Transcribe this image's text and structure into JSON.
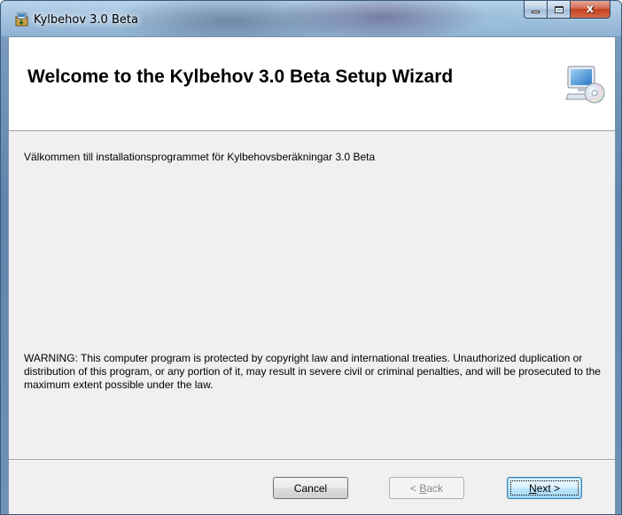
{
  "window": {
    "title": "Kylbehov 3.0 Beta",
    "icons": {
      "app": "installer-icon",
      "minimize": "minimize-icon",
      "maximize": "maximize-icon",
      "close": "close-icon"
    },
    "close_glyph": "x"
  },
  "banner": {
    "title": "Welcome to the Kylbehov 3.0 Beta Setup Wizard",
    "icon": "computer-cd-icon"
  },
  "body": {
    "welcome": "Välkommen till installationsprogrammet för Kylbehovsberäkningar 3.0 Beta",
    "warning": "WARNING: This computer program is protected by copyright law and international treaties. Unauthorized duplication or distribution of this program, or any portion of it, may result in severe civil or criminal penalties, and will be prosecuted to the maximum extent possible under the law."
  },
  "buttons": {
    "cancel": "Cancel",
    "back_prefix": "< ",
    "back_access": "B",
    "back_rest": "ack",
    "next_access": "N",
    "next_rest": "ext >"
  },
  "colors": {
    "accent": "#3c7fb1",
    "close_button": "#c2401f",
    "dialog_background": "#f0f0f0"
  }
}
